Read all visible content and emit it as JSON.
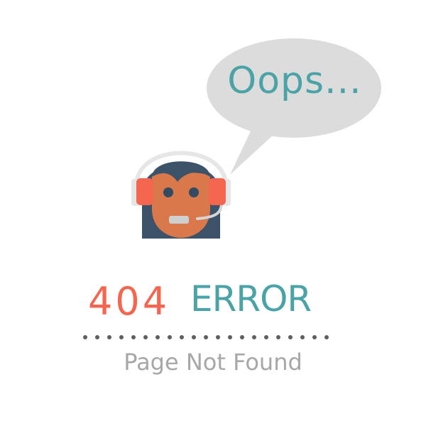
{
  "bubble": {
    "text": "Oops...",
    "color": "#4aa3a7",
    "fill": "#dcdcdc"
  },
  "avatar": {
    "icon": "support-agent-icon",
    "colors": {
      "hair": "#3c5268",
      "skin": "#d9784a",
      "headset_ear": "#f4664f",
      "headband": "#e6e6e6",
      "mic": "#d5d5d5"
    }
  },
  "error": {
    "code": "404",
    "word": "ERROR",
    "code_color": "#f4664f",
    "word_color": "#4aa3a7"
  },
  "divider": {
    "style": "dotted",
    "color": "#5f5f5f"
  },
  "subtitle": {
    "text": "Page Not Found",
    "color": "#a7a7a7"
  }
}
